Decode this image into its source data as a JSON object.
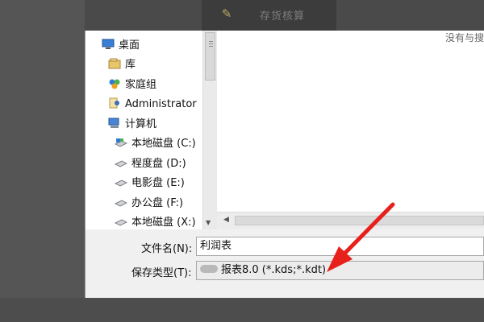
{
  "background": {
    "app_bar_label": "存货核算",
    "app_bar_icon": "app-icon"
  },
  "dialog": {
    "content_hint": "没有与搜",
    "nav": {
      "items": [
        {
          "label": "桌面",
          "icon": "desktop-icon"
        },
        {
          "label": "库",
          "icon": "library-icon"
        },
        {
          "label": "家庭组",
          "icon": "homegroup-icon"
        },
        {
          "label": "Administrator",
          "icon": "user-folder-icon"
        },
        {
          "label": "计算机",
          "icon": "computer-icon"
        },
        {
          "label": "本地磁盘 (C:)",
          "icon": "system-drive-icon"
        },
        {
          "label": "程度盘 (D:)",
          "icon": "drive-icon"
        },
        {
          "label": "电影盘 (E:)",
          "icon": "drive-icon"
        },
        {
          "label": "办公盘 (F:)",
          "icon": "drive-icon"
        },
        {
          "label": "本地磁盘 (X:)",
          "icon": "drive-icon"
        }
      ]
    },
    "filename": {
      "label": "文件名(N):",
      "value": "利润表"
    },
    "filetype": {
      "label": "保存类型(T):",
      "value": "报表8.0 (*.kds;*.kdt)"
    }
  },
  "colors": {
    "arrow": "#e8201c",
    "dialog_bg": "#f0f0f0",
    "backdrop": "#4a4a4a"
  }
}
